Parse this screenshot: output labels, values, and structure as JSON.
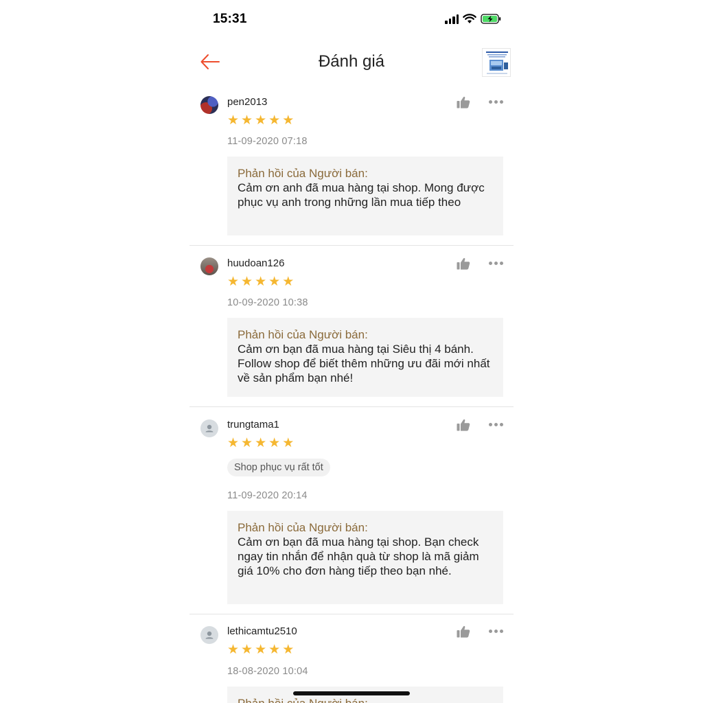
{
  "status": {
    "time": "15:31"
  },
  "header": {
    "title": "Đánh giá"
  },
  "reviews": [
    {
      "username": "pen2013",
      "avatar": "photo1",
      "rating": 5,
      "tag": "",
      "date": "11-09-2020 07:18",
      "reply_title": "Phản hồi của Người bán:",
      "reply_text": "Cảm ơn anh đã mua hàng tại shop. Mong được phục vụ anh trong những lần mua tiếp theo"
    },
    {
      "username": "huudoan126",
      "avatar": "photo2",
      "rating": 5,
      "tag": "",
      "date": "10-09-2020 10:38",
      "reply_title": "Phản hồi của Người bán:",
      "reply_text": "Cảm ơn bạn đã mua hàng tại Siêu thị 4 bánh. Follow shop để biết thêm những ưu đãi mới nhất về sản phẩm bạn nhé!"
    },
    {
      "username": "trungtama1",
      "avatar": "default",
      "rating": 5,
      "tag": "Shop phục vụ rất tốt",
      "date": "11-09-2020 20:14",
      "reply_title": "Phản hồi của Người bán:",
      "reply_text": "Cảm ơn bạn đã mua hàng tại shop. Bạn check ngay tin nhắn để nhận quà từ shop là mã giảm giá 10% cho đơn hàng tiếp theo bạn nhé."
    },
    {
      "username": "lethicamtu2510",
      "avatar": "default",
      "rating": 5,
      "tag": "",
      "date": "18-08-2020 10:04",
      "reply_title": "Phản hồi của Người bán:",
      "reply_text": ""
    }
  ],
  "colors": {
    "accent": "#ee4d2d",
    "star": "#f5b731",
    "reply_title": "#8a6a3a"
  }
}
